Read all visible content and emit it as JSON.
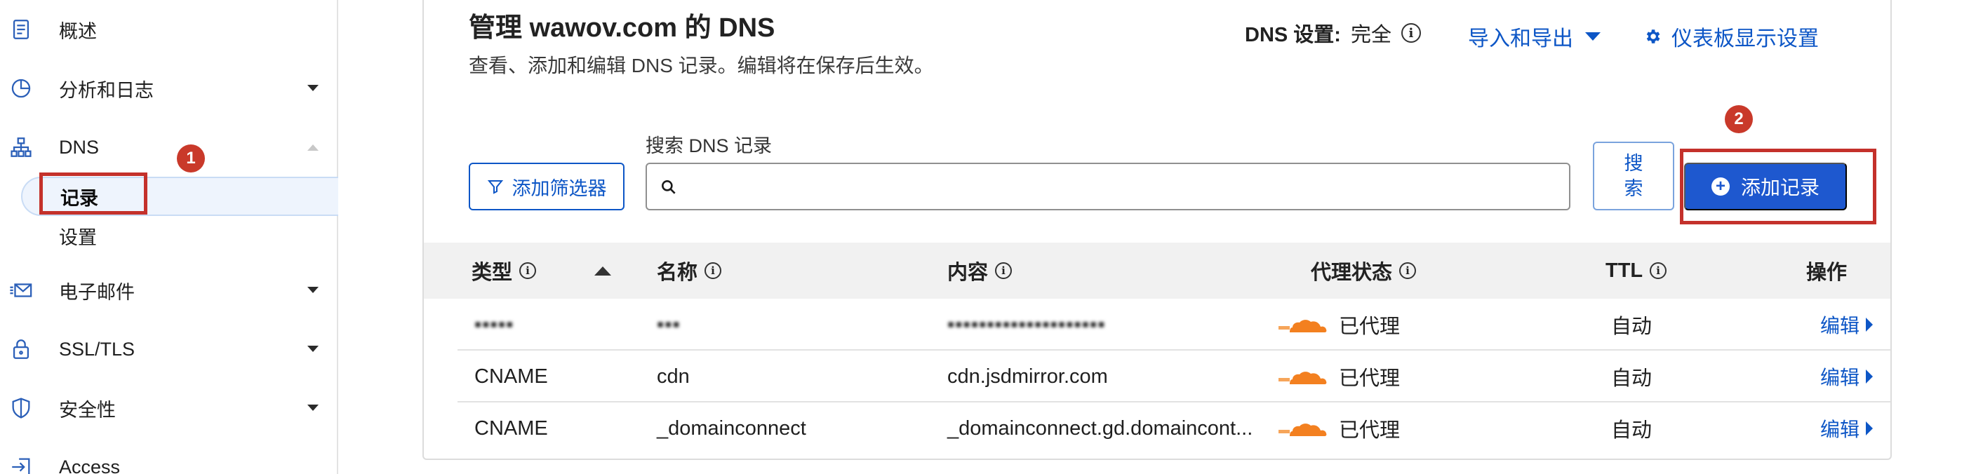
{
  "sidebar": {
    "items": [
      {
        "label": "概述"
      },
      {
        "label": "分析和日志"
      },
      {
        "label": "DNS"
      },
      {
        "label": "电子邮件"
      },
      {
        "label": "SSL/TLS"
      },
      {
        "label": "安全性"
      },
      {
        "label": "Access"
      }
    ],
    "dns_sub": [
      {
        "label": "记录"
      },
      {
        "label": "设置"
      }
    ]
  },
  "annotations": {
    "badge1": "1",
    "badge2": "2"
  },
  "header": {
    "title_prefix": "管理 ",
    "title_domain": "wawov.com",
    "title_suffix": " 的 DNS",
    "description": "查看、添加和编辑 DNS 记录。编辑将在保存后生效。",
    "dns_settings_key": "DNS 设置:",
    "dns_settings_value": "完全",
    "import_export": "导入和导出",
    "dashboard_settings": "仪表板显示设置"
  },
  "toolbar": {
    "filter_label": "添加筛选器",
    "search_label": "搜索 DNS 记录",
    "search_value": "",
    "search_button": "搜\n索",
    "add_record": "添加记录"
  },
  "table": {
    "columns": {
      "type": "类型",
      "name": "名称",
      "content": "内容",
      "proxy": "代理状态",
      "ttl": "TTL",
      "actions": "操作"
    },
    "rows": [
      {
        "type": "▪▪▪▪▪",
        "name": "▪▪▪",
        "content": "▪▪▪▪▪▪▪▪▪▪▪▪▪▪▪▪▪▪▪▪",
        "proxy": "已代理",
        "ttl": "自动",
        "action": "编辑",
        "blurred": true
      },
      {
        "type": "CNAME",
        "name": "cdn",
        "content": "cdn.jsdmirror.com",
        "proxy": "已代理",
        "ttl": "自动",
        "action": "编辑"
      },
      {
        "type": "CNAME",
        "name": "_domainconnect",
        "content": "_domainconnect.gd.domaincont...",
        "proxy": "已代理",
        "ttl": "自动",
        "action": "编辑"
      }
    ]
  },
  "colors": {
    "accent": "#1e58cf",
    "link": "#0d56c6",
    "annotation": "#c4312b",
    "proxy_cloud": "#f38020"
  }
}
